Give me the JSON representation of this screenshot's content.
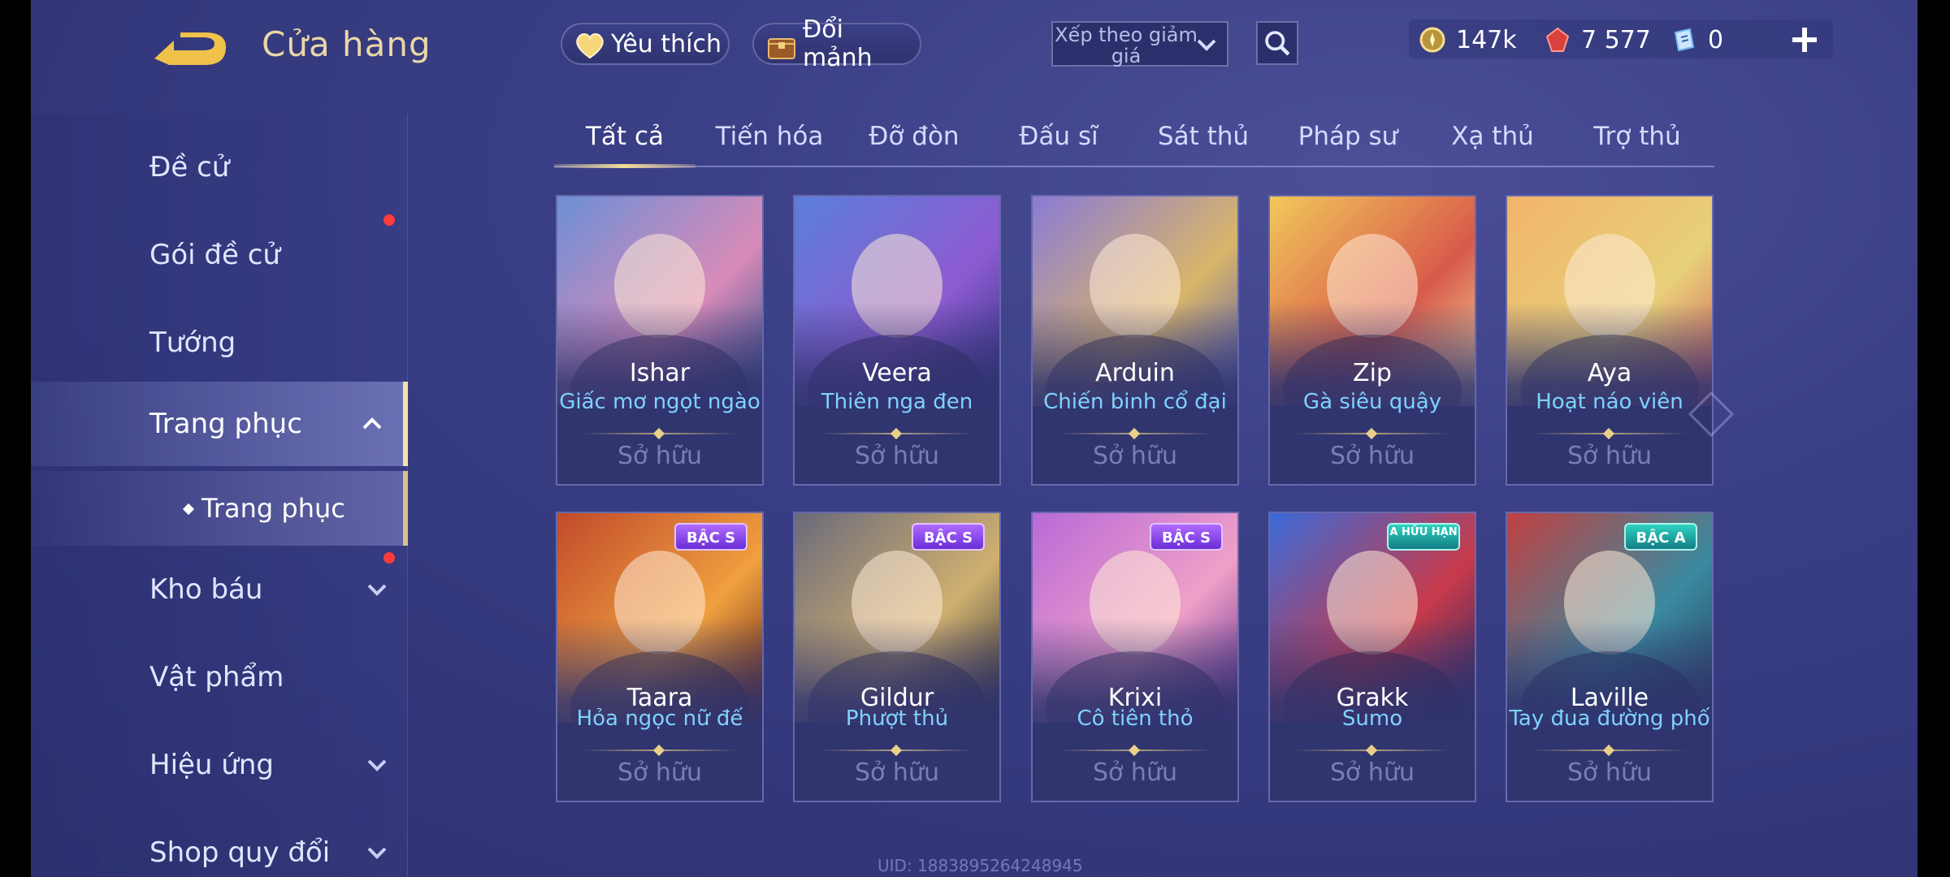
{
  "header": {
    "title": "Cửa hàng",
    "back_icon": "back-arrow-icon"
  },
  "sidebar": {
    "items": [
      {
        "label": "Đề cử"
      },
      {
        "label": "Gói đề cử",
        "badge": true
      },
      {
        "label": "Tướng"
      },
      {
        "label": "Trang phục",
        "expanded": true
      },
      {
        "label": "Kho báu",
        "badge": true
      },
      {
        "label": "Vật phẩm"
      },
      {
        "label": "Hiệu ứng"
      },
      {
        "label": "Shop quy đổi"
      }
    ],
    "sub_item": {
      "label": "Trang phục"
    }
  },
  "toolbar": {
    "favorites_label": "Yêu thích",
    "exchange_label": "Đổi mảnh",
    "sort_label": "Xếp theo giảm giá"
  },
  "currencies": [
    {
      "icon": "gold-coin-icon",
      "value": "147k"
    },
    {
      "icon": "red-gem-icon",
      "value": "7 577"
    },
    {
      "icon": "voucher-icon",
      "value": "0"
    }
  ],
  "tabs": [
    {
      "label": "Tất cả",
      "active": true
    },
    {
      "label": "Tiến hóa"
    },
    {
      "label": "Đỡ đòn"
    },
    {
      "label": "Đấu sĩ"
    },
    {
      "label": "Sát thủ"
    },
    {
      "label": "Pháp sư"
    },
    {
      "label": "Xạ thủ"
    },
    {
      "label": "Trợ thủ"
    }
  ],
  "cards": [
    {
      "hero": "Ishar",
      "skin": "Giấc mơ ngọt ngào",
      "status": "Sở hữu",
      "tier": ""
    },
    {
      "hero": "Veera",
      "skin": "Thiên nga đen",
      "status": "Sở hữu",
      "tier": ""
    },
    {
      "hero": "Arduin",
      "skin": "Chiến binh cổ đại",
      "status": "Sở hữu",
      "tier": ""
    },
    {
      "hero": "Zip",
      "skin": "Gà siêu quậy",
      "status": "Sở hữu",
      "tier": ""
    },
    {
      "hero": "Aya",
      "skin": "Hoạt náo viên",
      "status": "Sở hữu",
      "tier": ""
    },
    {
      "hero": "Taara",
      "skin": "Hỏa ngọc nữ đế",
      "status": "Sở hữu",
      "tier": "BẬC S"
    },
    {
      "hero": "Gildur",
      "skin": "Phượt thủ",
      "status": "Sở hữu",
      "tier": "BẬC S"
    },
    {
      "hero": "Krixi",
      "skin": "Cô tiên thỏ",
      "status": "Sở hữu",
      "tier": "BẬC S"
    },
    {
      "hero": "Grakk",
      "skin": "Sumo",
      "status": "Sở hữu",
      "tier": "A HỮU HẠN"
    },
    {
      "hero": "Laville",
      "skin": "Tay đua đường phố",
      "status": "Sở hữu",
      "tier": "BẬC A"
    }
  ],
  "uid_text": "UID: 1883895264248945",
  "colors": {
    "accent_gold": "#e9d7a6",
    "skin_name": "#7fd1ff",
    "badge_red": "#ff3b3b"
  }
}
